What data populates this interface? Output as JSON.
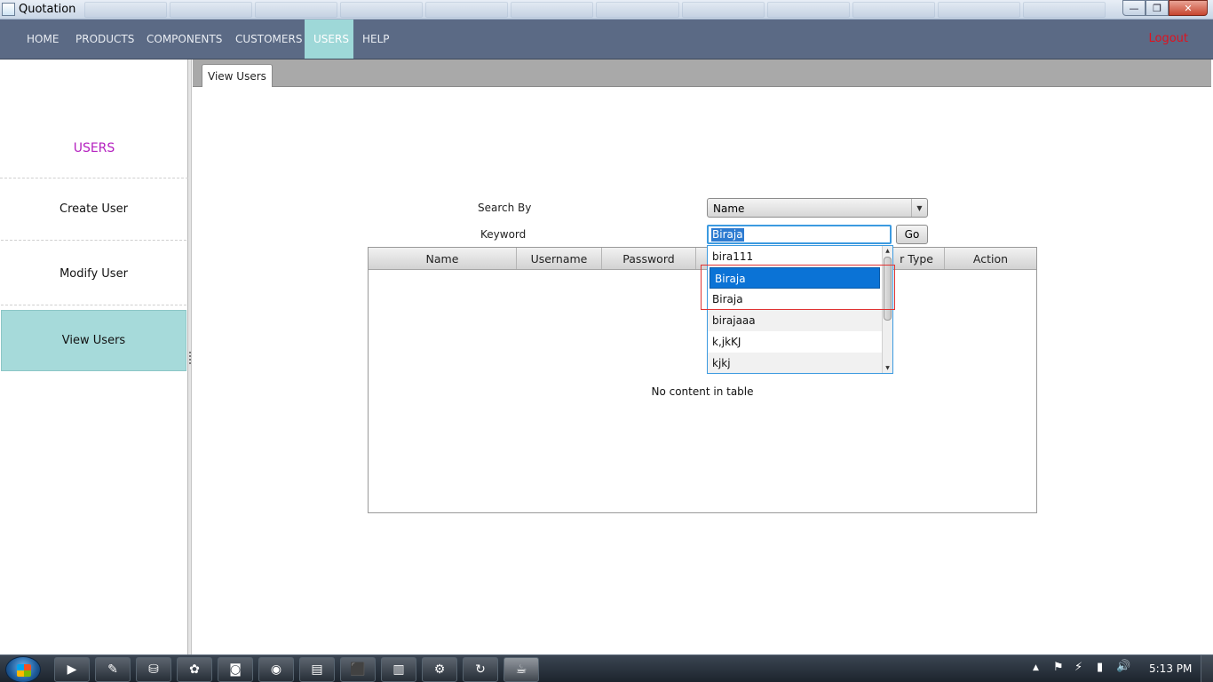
{
  "window": {
    "title": "Quotation",
    "controls": {
      "minimize": "—",
      "maximize": "❐",
      "close": "✕"
    }
  },
  "menubar": {
    "items": [
      {
        "label": "HOME",
        "active": false
      },
      {
        "label": "PRODUCTS",
        "active": false
      },
      {
        "label": "COMPONENTS",
        "active": false
      },
      {
        "label": "CUSTOMERS",
        "active": false
      },
      {
        "label": "USERS",
        "active": true
      },
      {
        "label": "HELP",
        "active": false
      }
    ],
    "logout": "Logout",
    "colors": {
      "background": "#5b6a85",
      "active": "#9ed8d8",
      "logout": "#e0121f"
    }
  },
  "sidebar": {
    "heading": "USERS",
    "items": [
      {
        "label": "Create User",
        "active": false
      },
      {
        "label": "Modify User",
        "active": false
      },
      {
        "label": "View Users",
        "active": true
      }
    ],
    "colors": {
      "heading": "#b41fbf",
      "active": "#a6dada"
    }
  },
  "tabs": [
    {
      "label": "View Users",
      "active": true
    }
  ],
  "search": {
    "search_by_label": "Search By",
    "search_by_value": "Name",
    "keyword_label": "Keyword",
    "keyword_value": "Biraja",
    "go_label": "Go"
  },
  "table": {
    "columns": [
      "Name",
      "Username",
      "Password",
      "User Type",
      "Action"
    ],
    "visible_columns": [
      "Name",
      "Username",
      "Password",
      "",
      "r Type",
      "Action"
    ],
    "rows": [],
    "placeholder": "No content in table"
  },
  "autocomplete": {
    "options": [
      {
        "label": "bira111",
        "selected": false
      },
      {
        "label": "Biraja",
        "selected": true
      },
      {
        "label": "Biraja",
        "selected": false
      },
      {
        "label": "birajaaa",
        "selected": false
      },
      {
        "label": "k,jkKJ",
        "selected": false
      },
      {
        "label": "kjkj",
        "selected": false
      }
    ],
    "highlight_color": "#0b73d6",
    "annotation_color": "#e03333"
  },
  "taskbar": {
    "start": "start-button",
    "apps": [
      {
        "icon": "media-player-icon",
        "glyph": "▶",
        "active": false
      },
      {
        "icon": "tools-icon",
        "glyph": "✎",
        "active": false
      },
      {
        "icon": "network-icon",
        "glyph": "⛁",
        "active": false
      },
      {
        "icon": "paint-icon",
        "glyph": "✿",
        "active": false
      },
      {
        "icon": "app-icon",
        "glyph": "◙",
        "active": false
      },
      {
        "icon": "firefox-icon",
        "glyph": "◉",
        "active": false
      },
      {
        "icon": "explorer-icon",
        "glyph": "▤",
        "active": false
      },
      {
        "icon": "pdf-icon",
        "glyph": "⬛",
        "active": false
      },
      {
        "icon": "notepad-icon",
        "glyph": "▥",
        "active": false
      },
      {
        "icon": "settings-icon",
        "glyph": "⚙",
        "active": false
      },
      {
        "icon": "refresh-icon",
        "glyph": "↻",
        "active": false
      },
      {
        "icon": "java-icon",
        "glyph": "☕",
        "active": true
      }
    ],
    "tray": {
      "show_hidden": "▲",
      "flag": "⚑",
      "power": "⚡",
      "signal": "▮",
      "volume": "🔊",
      "time": "5:13 PM"
    }
  }
}
